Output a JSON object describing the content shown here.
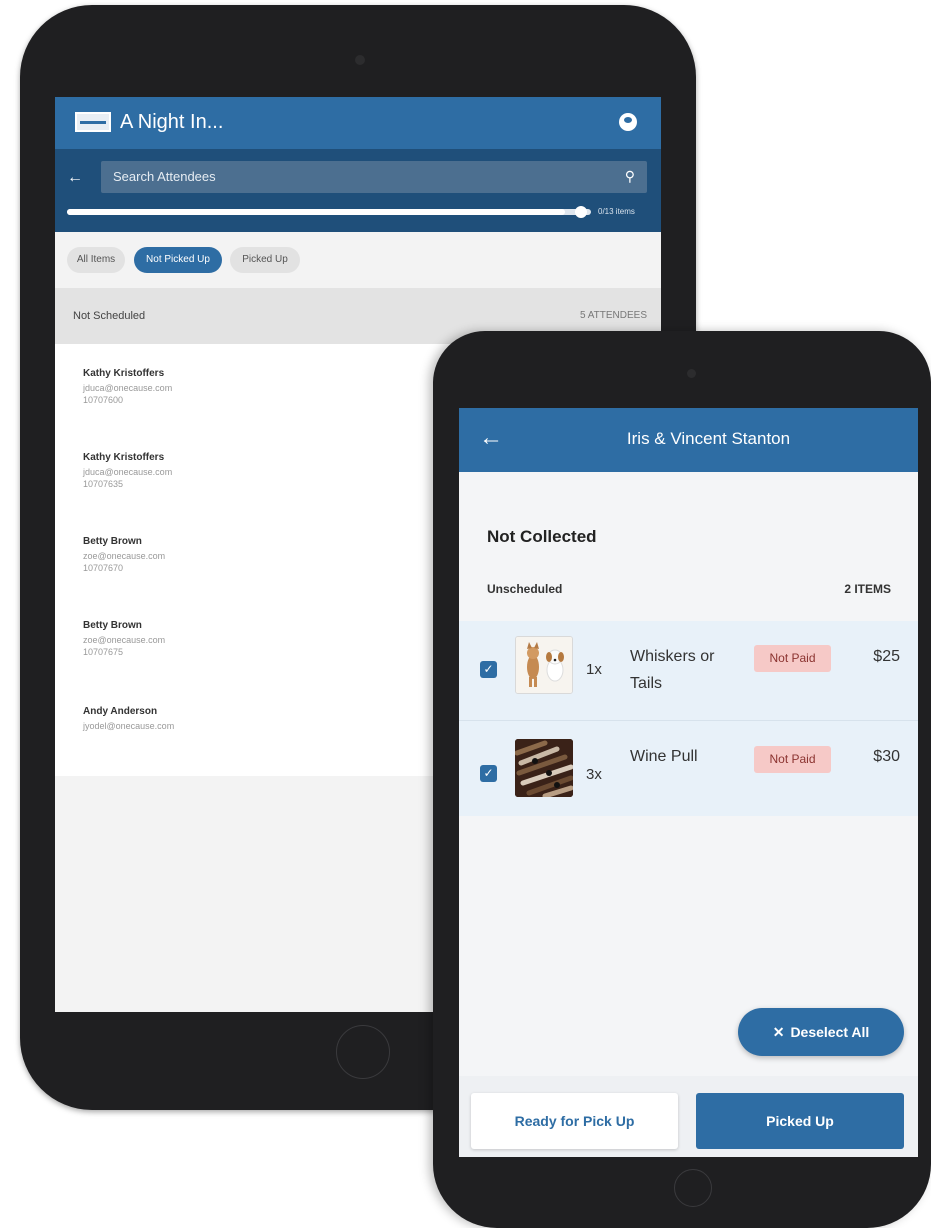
{
  "back_tablet": {
    "app_title": "A Night In...",
    "search_placeholder": "Search Attendees",
    "progress": {
      "label": "0/13 items",
      "fraction": 0.95
    },
    "filters": [
      {
        "label": "All Items",
        "active": false
      },
      {
        "label": "Not Picked Up",
        "active": true
      },
      {
        "label": "Picked Up",
        "active": false
      }
    ],
    "section": {
      "title": "Not Scheduled",
      "count": "5 ATTENDEES"
    },
    "attendees": [
      {
        "name": "Kathy Kristoffers",
        "email": "jduca@onecause.com",
        "id": "10707600"
      },
      {
        "name": "Kathy Kristoffers",
        "email": "jduca@onecause.com",
        "id": "10707635"
      },
      {
        "name": "Betty Brown",
        "email": "zoe@onecause.com",
        "id": "10707670"
      },
      {
        "name": "Betty Brown",
        "email": "zoe@onecause.com",
        "id": "10707675"
      },
      {
        "name": "Andy Anderson",
        "email": "jyodel@onecause.com",
        "id": ""
      }
    ]
  },
  "front_tablet": {
    "header_title": "Iris & Vincent Stanton",
    "heading": "Not Collected",
    "group_label": "Unscheduled",
    "group_count": "2 ITEMS",
    "items": [
      {
        "qty": "1x",
        "name": "Whiskers or Tails",
        "status": "Not Paid",
        "price": "$25",
        "checked": true
      },
      {
        "qty": "3x",
        "name": "Wine Pull",
        "status": "Not Paid",
        "price": "$30",
        "checked": true
      }
    ],
    "deselect_label": "Deselect All",
    "ready_label": "Ready for Pick Up",
    "picked_label": "Picked Up"
  },
  "colors": {
    "primary": "#2e6da4",
    "dark_bar": "#1f4f7a",
    "badge_bg": "#f6c9c7",
    "badge_text": "#8b3330"
  }
}
